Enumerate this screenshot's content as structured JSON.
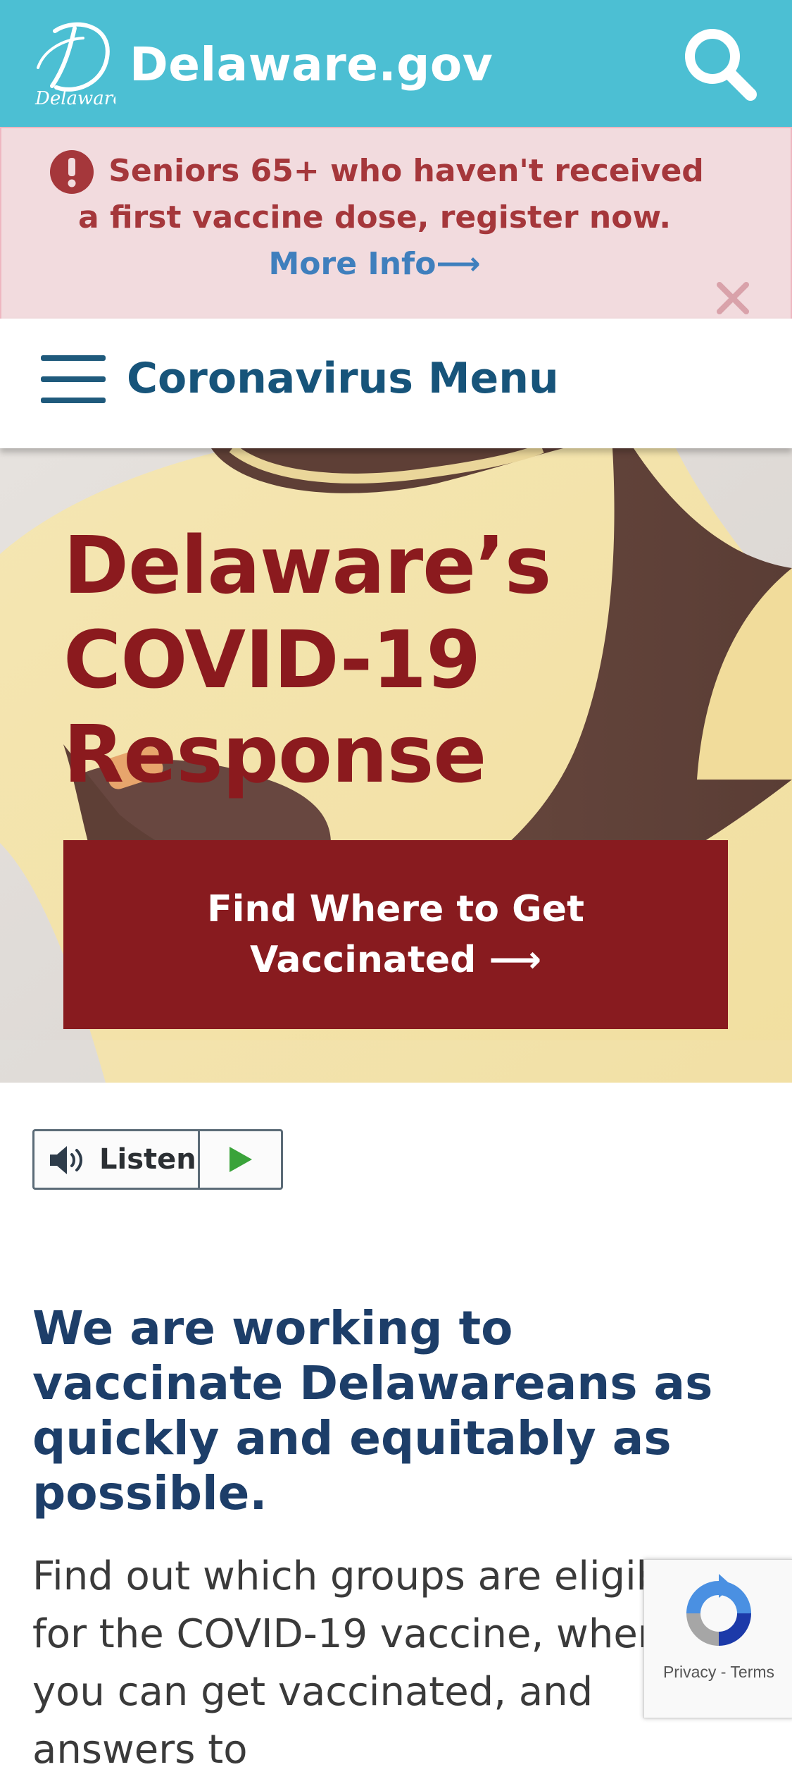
{
  "header": {
    "logo_script": "Delaware",
    "site_name": "Delaware.gov",
    "search_icon": "search-icon"
  },
  "alert": {
    "message": "Seniors 65+ who haven't received a first vaccine dose, register now.",
    "link_text": "More Info",
    "link_arrow": "⟶",
    "alert_icon": "exclamation-circle-icon",
    "close_icon": "close-icon"
  },
  "menu": {
    "label": "Coronavirus Menu",
    "icon": "hamburger-icon"
  },
  "hero": {
    "title_lines": [
      "Delaware’s",
      "COVID-19",
      "Response"
    ],
    "cta_label": "Find Where to Get Vaccinated",
    "cta_arrow": "⟶"
  },
  "listen": {
    "label": "Listen",
    "speaker_icon": "speaker-icon",
    "play_icon": "play-icon"
  },
  "content": {
    "heading": "We are working to vaccinate Delawareans as quickly and equitably as possible.",
    "paragraph": "Find out which groups are eligible for the COVID-19 vaccine, where you can get vaccinated, and answers to"
  },
  "recaptcha": {
    "privacy": "Privacy",
    "separator": "-",
    "terms": "Terms"
  },
  "colors": {
    "header_bg": "#4cbfd3",
    "alert_bg": "#f2dbde",
    "alert_text": "#a5373b",
    "link": "#3f7fbd",
    "menu_text": "#17547a",
    "hero_title": "#8b1a1e",
    "cta_bg": "#881b1f",
    "heading": "#1d3e69",
    "play_green": "#3aa33a"
  }
}
